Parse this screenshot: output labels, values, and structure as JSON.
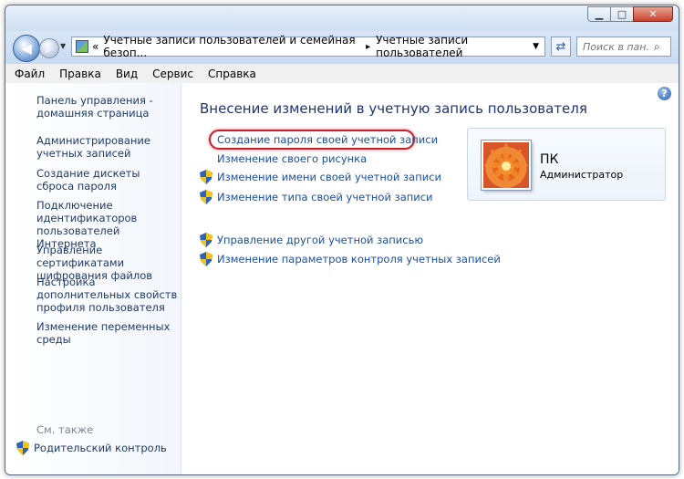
{
  "window": {
    "buttons": {
      "minimize": "▁",
      "maximize": "□",
      "close": "✕"
    }
  },
  "nav": {
    "address_segments": [
      "«",
      "Учетные записи пользователей и семейная безоп...",
      "Учетные записи пользователей"
    ],
    "address_separator": "▸",
    "search_placeholder": "Поиск в пан..."
  },
  "menu": [
    "Файл",
    "Правка",
    "Вид",
    "Сервис",
    "Справка"
  ],
  "sidebar": {
    "links": [
      "Панель управления - домашняя страница",
      "Администрирование учетных записей",
      "Создание дискеты сброса пароля",
      "Подключение идентификаторов пользователей Интернета",
      "Управление сертификатами шифрования файлов",
      "Настройка дополнительных свойств профиля пользователя",
      "Изменение переменных среды"
    ],
    "see_also": "См. также",
    "parental_control": "Родительский контроль"
  },
  "main": {
    "heading": "Внесение изменений в учетную запись пользователя",
    "tasks": [
      "Создание пароля своей учетной записи",
      "Изменение своего рисунка",
      "Изменение имени своей учетной записи",
      "Изменение типа своей учетной записи"
    ],
    "other_tasks": [
      "Управление другой учетной записью",
      "Изменение параметров контроля учетных записей"
    ],
    "help": "?"
  },
  "user": {
    "name": "ПК",
    "role": "Администратор"
  },
  "colors": {
    "link": "#1a4ea0",
    "heading": "#1e3478",
    "highlight": "#c8202a"
  }
}
